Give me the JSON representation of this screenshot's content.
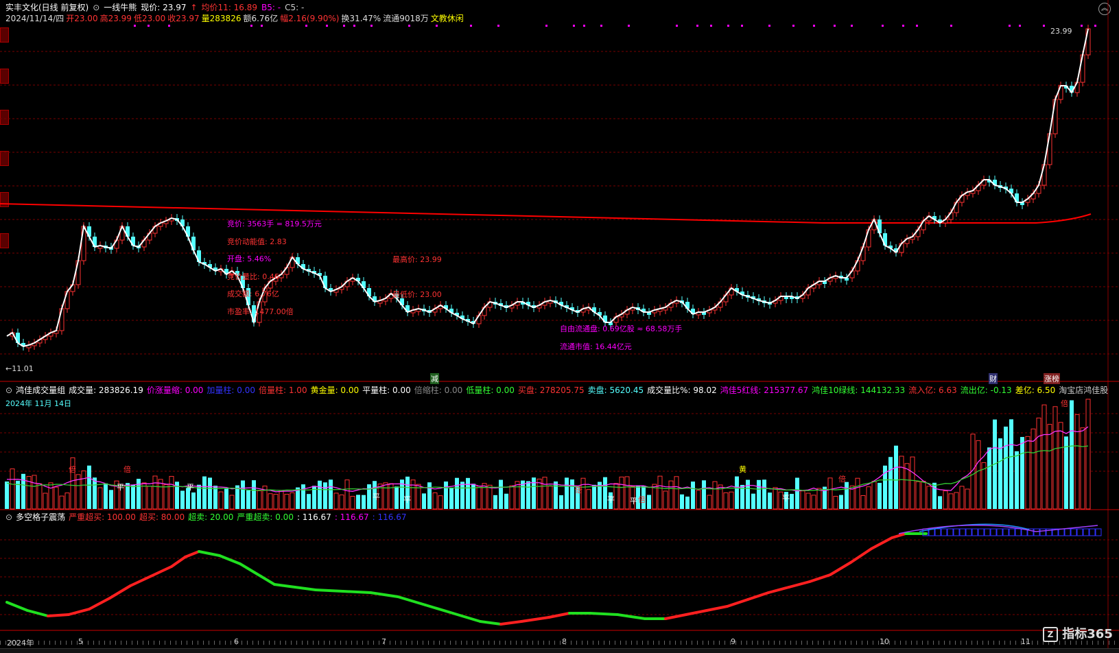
{
  "header": {
    "stock_name": "实丰文化(日线 前复权)",
    "title_circle": "⊙",
    "style_name": "一线牛熊",
    "price_label": "现价: 23.97",
    "up_arrow": "↑",
    "avg_label": "均价11: 16.89",
    "b5": "B5: -",
    "c5": "C5: -",
    "line2_date": "2024/11/14/四",
    "open": "开23.00",
    "high": "高23.99",
    "low": "低23.00",
    "close": "收23.97",
    "volume": "量283826",
    "amount": "额6.76亿",
    "change": "幅2.16(9.90%)",
    "turnover": "换31.47%",
    "float": "流通9018万",
    "concept": "文教休闲",
    "price_max_label": "23.99",
    "price_min_label": "←11.01"
  },
  "annotations": {
    "bid_price": "竞价: 3563手 = 819.5万元",
    "bid_momentum": "竞价动能值: 2.83",
    "open_pct": "开盘: 5.46%",
    "bid_ratio": "竞价量比: 0.46",
    "amount": "成交额: 6.76亿",
    "pe_ratio": "市盈率: 1477.00倍",
    "highest": "最高价: 23.99",
    "lowest": "最低价: 23.00",
    "free_float": "自由流通盘: 0.69亿股 ≈ 68.58万手",
    "float_value": "流通市值: 16.44亿元"
  },
  "event_markers": {
    "jian": "减",
    "cai": "财",
    "zhangting": "涨榜"
  },
  "volume_panel": {
    "title": "鸿佳成交量组",
    "vol": "成交量: 283826.19",
    "price_up_shrink": "价涨量缩: 0.00",
    "add_bar": "加量柱: 0.00",
    "double_bar": "倍量柱: 1.00",
    "gold_bar": "黄金量: 0.00",
    "flat_bar": "平量柱: 0.00",
    "shrink_bar": "倍缩柱: 0.00",
    "low_bar": "低量柱: 0.00",
    "buy": "买盘: 278205.75",
    "sell": "卖盘: 5620.45",
    "ratio": "成交量比%: 98.02",
    "red5": "鸿佳5红线: 215377.67",
    "green10": "鸿佳10绿线: 144132.33",
    "inflow": "流入亿: 6.63",
    "outflow": "流出亿: -0.13",
    "diff": "差亿: 6.50",
    "shop": "淘宝店鸿佳股",
    "date": "2024年 11月 14日",
    "tags": [
      "倍",
      "倍",
      "平",
      "平",
      "平",
      "平",
      "倍",
      "平",
      "平",
      "倍",
      "黄",
      "平",
      "倍",
      "倍"
    ]
  },
  "osc_panel": {
    "title": "多空格子震荡",
    "severe_overbuy": "严重超买: 100.00",
    "overbuy": "超买: 80.00",
    "oversell": "超卖: 20.00",
    "severe_oversell": "严重超卖: 0.00",
    "v1": ": 116.67",
    "v2": ": 116.67",
    "v3": ": 116.67"
  },
  "x_axis": {
    "ticks": [
      "2024年",
      "5",
      "6",
      "7",
      "8",
      "9",
      "10",
      "11"
    ]
  },
  "watermark": "指标365",
  "colors": {
    "up": "#ff3232",
    "down": "#54ffff",
    "ma": "#ff0000",
    "magenta": "#ff00ff",
    "yellow": "#ffff00",
    "green": "#00ff00"
  }
}
